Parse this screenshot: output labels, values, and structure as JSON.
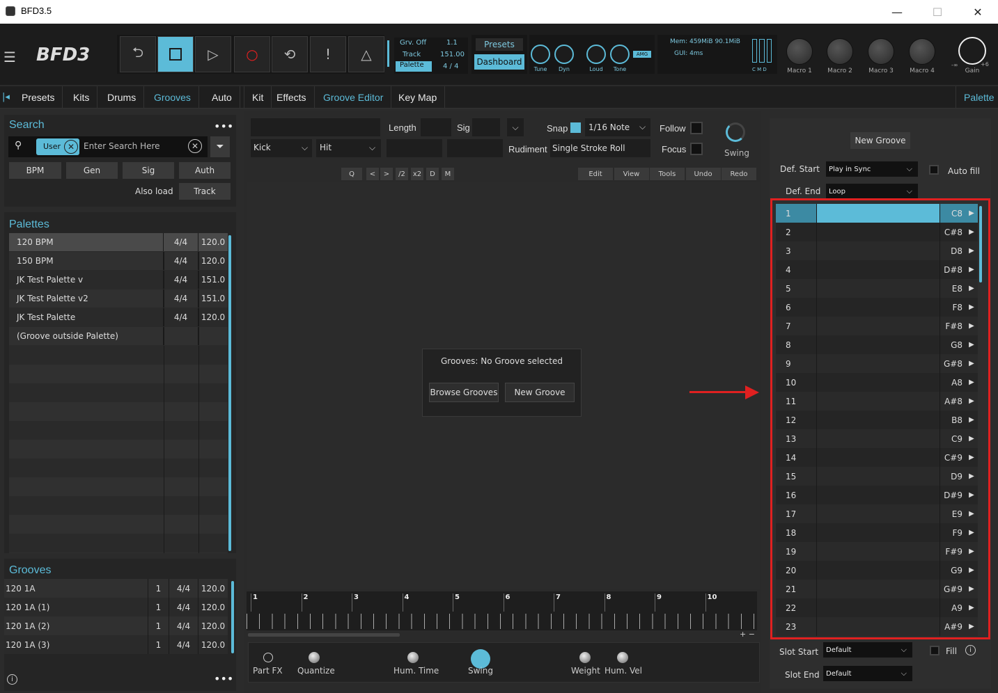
{
  "window": {
    "title": "BFD3.5"
  },
  "toolbar": {
    "logo": "BFD3",
    "info": {
      "grv_off_label": "Grv. Off",
      "grv_off_val": "1.1",
      "track_label": "Track",
      "track_val": "151.00",
      "palette_label": "Palette",
      "palette_val": "4 / 4"
    },
    "presets_label": "Presets",
    "dashboard_label": "Dashboard",
    "knobs": [
      "Tune",
      "Dyn",
      "Loud",
      "Tone"
    ],
    "amg": "AMG",
    "mem": "Mem: 459MiB 90.1MiB",
    "gui": "GUI:  4ms",
    "cmd": "C  M  D",
    "macros": [
      "Macro 1",
      "Macro 2",
      "Macro 3",
      "Macro 4"
    ],
    "gain_label": "Gain",
    "gain_min": "-∞",
    "gain_max": "+6"
  },
  "tabs": {
    "left": [
      "Presets",
      "Kits",
      "Drums",
      "Grooves",
      "Auto"
    ],
    "right": [
      "Kit",
      "Effects",
      "Groove Editor",
      "Key Map"
    ],
    "palette": "Palette"
  },
  "search": {
    "title": "Search",
    "tag": "User",
    "placeholder": "Enter Search Here",
    "filters": [
      "BPM",
      "Gen",
      "Sig",
      "Auth"
    ],
    "also_load": "Also load",
    "track": "Track"
  },
  "palettes": {
    "title": "Palettes",
    "rows": [
      {
        "name": "120 BPM",
        "sig": "4/4",
        "bpm": "120.0"
      },
      {
        "name": "150 BPM",
        "sig": "4/4",
        "bpm": "120.0"
      },
      {
        "name": "JK Test Palette v",
        "sig": "4/4",
        "bpm": "151.0"
      },
      {
        "name": "JK Test Palette v2",
        "sig": "4/4",
        "bpm": "151.0"
      },
      {
        "name": "JK Test Palette",
        "sig": "4/4",
        "bpm": "120.0"
      },
      {
        "name": "(Groove outside Palette)",
        "sig": "",
        "bpm": ""
      }
    ]
  },
  "grooves": {
    "title": "Grooves",
    "rows": [
      {
        "name": "120 1A",
        "n": "1",
        "sig": "4/4",
        "bpm": "120.0"
      },
      {
        "name": "120 1A (1)",
        "n": "1",
        "sig": "4/4",
        "bpm": "120.0"
      },
      {
        "name": "120 1A (2)",
        "n": "1",
        "sig": "4/4",
        "bpm": "120.0"
      },
      {
        "name": "120 1A (3)",
        "n": "1",
        "sig": "4/4",
        "bpm": "120.0"
      }
    ]
  },
  "editor": {
    "length_label": "Length",
    "sig_label": "Sig",
    "snap_label": "Snap",
    "snap_value": "1/16 Note",
    "follow_label": "Follow",
    "focus_label": "Focus",
    "kick": "Kick",
    "hit": "Hit",
    "rudiment_label": "Rudiment",
    "rudiment_value": "Single Stroke Roll",
    "swing_label": "Swing",
    "small_btns": [
      "Q",
      "<",
      ">",
      "/2",
      "x2",
      "D",
      "M"
    ],
    "menu_btns": [
      "Edit",
      "View",
      "Tools",
      "Undo",
      "Redo"
    ],
    "no_groove": "Grooves: No Groove selected",
    "browse": "Browse Grooves",
    "new_groove": "New Groove",
    "ruler": [
      "1",
      "2",
      "3",
      "4",
      "5",
      "6",
      "7",
      "8",
      "9",
      "10"
    ],
    "bottom": [
      "Part FX",
      "Quantize",
      "Hum. Time",
      "Swing",
      "Weight",
      "Hum. Vel"
    ]
  },
  "palette_panel": {
    "new_groove": "New Groove",
    "def_start_label": "Def. Start",
    "def_start_value": "Play in Sync",
    "auto_fill": "Auto fill",
    "def_end_label": "Def. End",
    "def_end_value": "Loop",
    "slots": [
      {
        "n": "1",
        "note": "C8"
      },
      {
        "n": "2",
        "note": "C#8"
      },
      {
        "n": "3",
        "note": "D8"
      },
      {
        "n": "4",
        "note": "D#8"
      },
      {
        "n": "5",
        "note": "E8"
      },
      {
        "n": "6",
        "note": "F8"
      },
      {
        "n": "7",
        "note": "F#8"
      },
      {
        "n": "8",
        "note": "G8"
      },
      {
        "n": "9",
        "note": "G#8"
      },
      {
        "n": "10",
        "note": "A8"
      },
      {
        "n": "11",
        "note": "A#8"
      },
      {
        "n": "12",
        "note": "B8"
      },
      {
        "n": "13",
        "note": "C9"
      },
      {
        "n": "14",
        "note": "C#9"
      },
      {
        "n": "15",
        "note": "D9"
      },
      {
        "n": "16",
        "note": "D#9"
      },
      {
        "n": "17",
        "note": "E9"
      },
      {
        "n": "18",
        "note": "F9"
      },
      {
        "n": "19",
        "note": "F#9"
      },
      {
        "n": "20",
        "note": "G9"
      },
      {
        "n": "21",
        "note": "G#9"
      },
      {
        "n": "22",
        "note": "A9"
      },
      {
        "n": "23",
        "note": "A#9"
      }
    ],
    "slot_start_label": "Slot Start",
    "slot_start_value": "Default",
    "fill_label": "Fill",
    "slot_end_label": "Slot End",
    "slot_end_value": "Default"
  },
  "colors": {
    "accent": "#5cbbd8",
    "highlight": "#e02020"
  }
}
